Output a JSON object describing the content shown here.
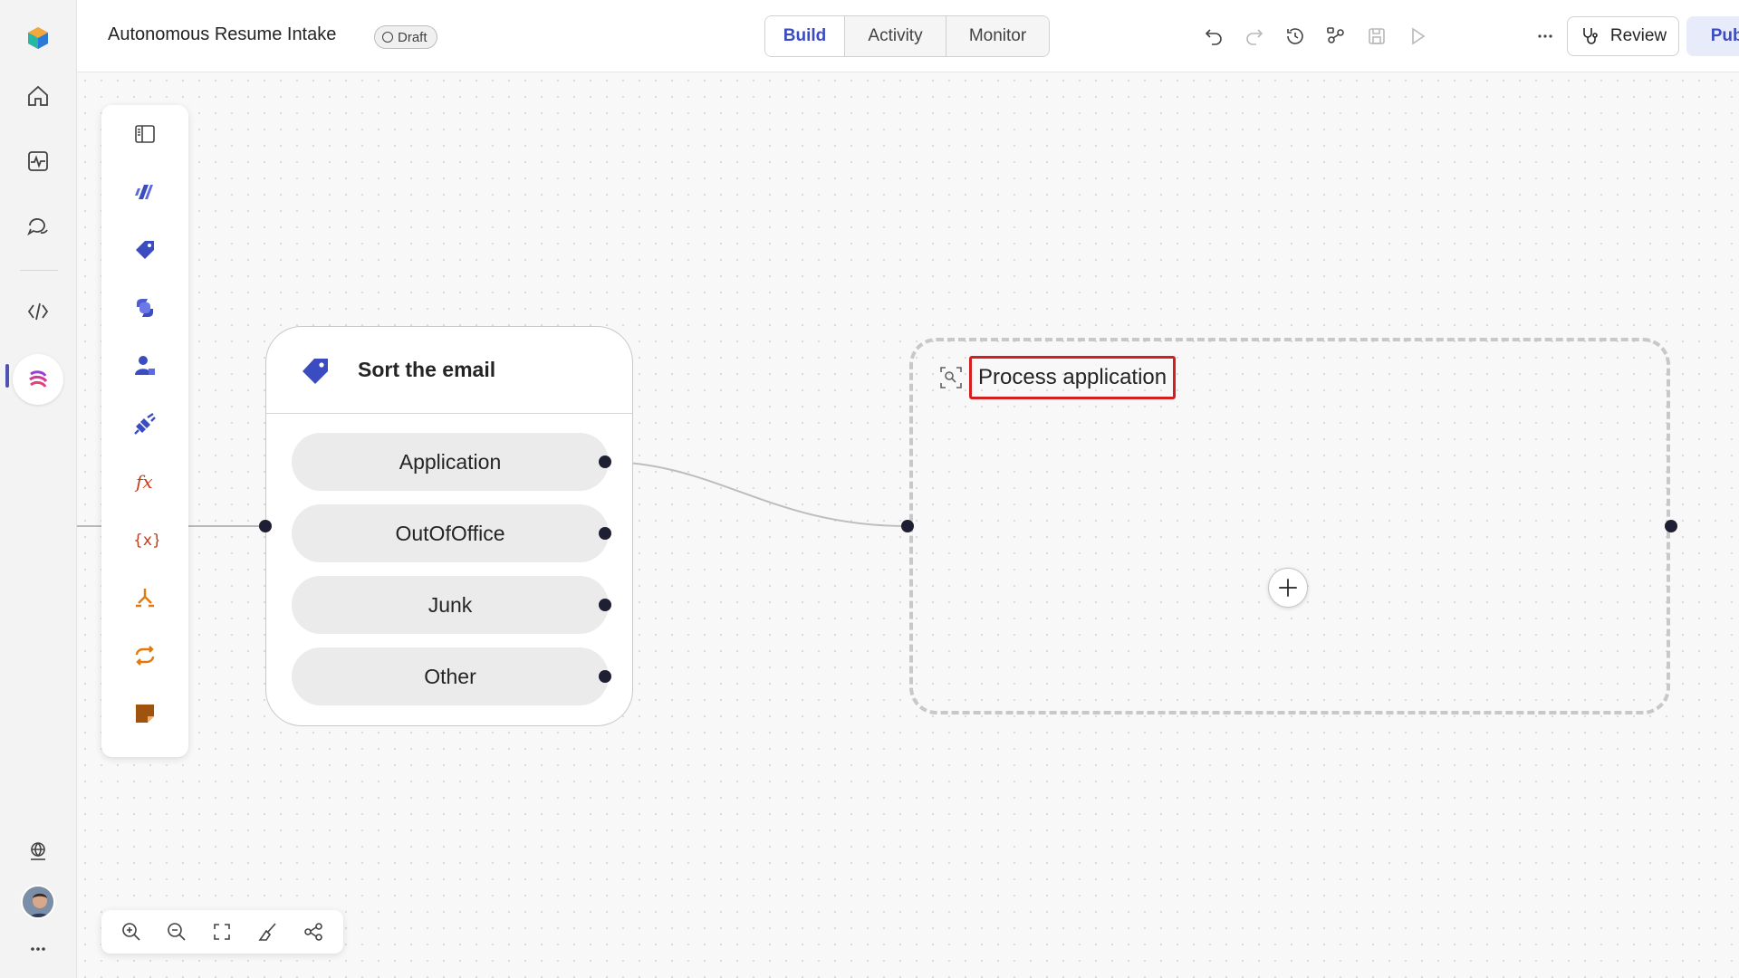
{
  "app": {
    "title": "Autonomous Resume Intake",
    "status": "Draft"
  },
  "tabs": [
    {
      "label": "Build",
      "active": true
    },
    {
      "label": "Activity",
      "active": false
    },
    {
      "label": "Monitor",
      "active": false
    }
  ],
  "toolbar": {
    "review_label": "Review",
    "publish_label": "Publish"
  },
  "rail": {
    "icons": [
      "app-logo-icon",
      "home-icon",
      "activity-icon",
      "chat-icon",
      "code-icon",
      "workflow-icon",
      "globe-icon",
      "more-icon"
    ],
    "active": "workflow-icon"
  },
  "toolbox": {
    "icons": [
      "collapse-panel-icon",
      "agent-icon",
      "tag-icon",
      "copilot-icon",
      "human-icon",
      "plugin-icon",
      "formula-icon",
      "variable-icon",
      "condition-icon",
      "loop-icon",
      "note-icon"
    ]
  },
  "sort_node": {
    "title": "Sort the email",
    "branches": [
      "Application",
      "OutOfOffice",
      "Junk",
      "Other"
    ]
  },
  "group": {
    "title": "Process application"
  },
  "zoom_controls": [
    "zoom-in-icon",
    "zoom-out-icon",
    "fit-view-icon",
    "clean-up-icon",
    "minimap-icon"
  ],
  "colors": {
    "accent": "#3b4cc0",
    "highlight": "#d31f1f",
    "connector": "#1f1f33"
  }
}
